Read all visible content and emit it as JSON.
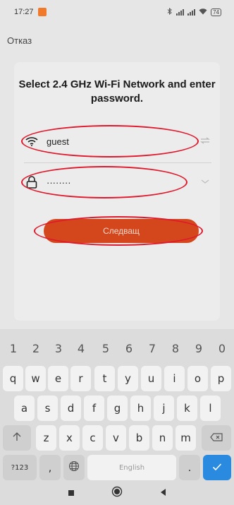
{
  "status_bar": {
    "time": "17:27",
    "battery": "74"
  },
  "header": {
    "cancel_label": "Отказ"
  },
  "form": {
    "title": "Select 2.4 GHz Wi-Fi Network and enter password.",
    "network_value": "guest",
    "password_value": "········",
    "next_label": "Следващ"
  },
  "keyboard": {
    "numbers": [
      "1",
      "2",
      "3",
      "4",
      "5",
      "6",
      "7",
      "8",
      "9",
      "0"
    ],
    "row1": [
      "q",
      "w",
      "e",
      "r",
      "t",
      "y",
      "u",
      "i",
      "o",
      "p"
    ],
    "row2": [
      "a",
      "s",
      "d",
      "f",
      "g",
      "h",
      "j",
      "k",
      "l"
    ],
    "row3": [
      "z",
      "x",
      "c",
      "v",
      "b",
      "n",
      "m"
    ],
    "symbols_label": "?123",
    "comma_label": ",",
    "space_label": "English",
    "period_label": "."
  },
  "colors": {
    "accent": "#d4471c",
    "annotation": "#e0182b",
    "enter": "#2a8ae0"
  },
  "icons": [
    "wifi-icon",
    "lock-icon",
    "swap-icon",
    "chevron-down-icon",
    "bluetooth-icon",
    "signal-icon",
    "battery-icon",
    "shift-icon",
    "backspace-icon",
    "globe-icon",
    "check-icon",
    "home-icon",
    "back-icon",
    "recents-icon"
  ]
}
